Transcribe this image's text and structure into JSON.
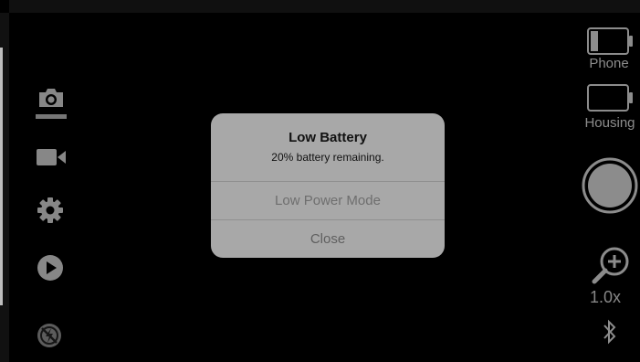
{
  "left_toolbar": {
    "photo_mode_icon": "camera-icon",
    "video_mode_icon": "video-camera-icon",
    "settings_icon": "gear-icon",
    "playback_icon": "play-icon",
    "flash_icon": "flash-off-icon"
  },
  "right_toolbar": {
    "phone_battery_label": "Phone",
    "housing_battery_label": "Housing",
    "zoom_level": "1.0x",
    "bluetooth_icon": "bluetooth-icon",
    "shutter_icon": "shutter-button",
    "zoom_icon": "zoom-in-icon",
    "phone_battery_level": 0.2
  },
  "alert": {
    "title": "Low Battery",
    "message": "20% battery remaining.",
    "buttons": [
      "Low Power Mode",
      "Close"
    ]
  },
  "colors": {
    "background": "#000000",
    "icon": "#cfcfcf",
    "dialog": "#a8a8a8"
  }
}
